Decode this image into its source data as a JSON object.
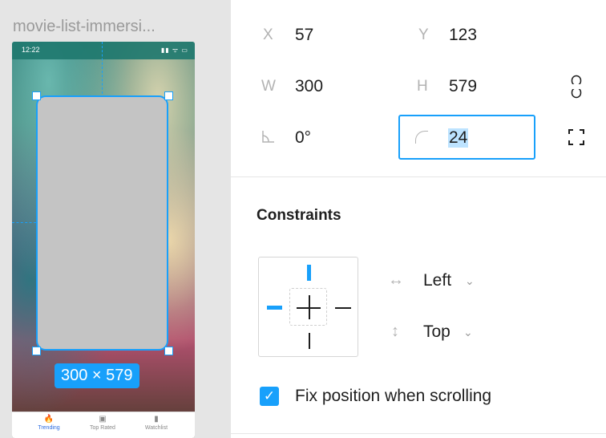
{
  "canvas": {
    "frame_title": "movie-list-immersi...",
    "phone": {
      "time": "12:22",
      "status_icons": "▮▮ ᯤ ▭",
      "tabs": [
        {
          "label": "Trending",
          "icon": "flame-icon",
          "active": true
        },
        {
          "label": "Top Rated",
          "icon": "ticket-icon",
          "active": false
        },
        {
          "label": "Watchlist",
          "icon": "bookmark-icon",
          "active": false
        }
      ]
    },
    "selection_size_label": "300 × 579"
  },
  "properties": {
    "x": {
      "label": "X",
      "value": "57"
    },
    "y": {
      "label": "Y",
      "value": "123"
    },
    "w": {
      "label": "W",
      "value": "300"
    },
    "h": {
      "label": "H",
      "value": "579"
    },
    "rotation": {
      "value": "0°"
    },
    "corner_radius": {
      "value": "24"
    }
  },
  "constraints": {
    "title": "Constraints",
    "horizontal": "Left",
    "vertical": "Top"
  },
  "fix_position": {
    "label": "Fix position when scrolling",
    "checked": true
  },
  "colors": {
    "accent": "#18a0fb",
    "selection_fill": "#c4c4c4"
  }
}
